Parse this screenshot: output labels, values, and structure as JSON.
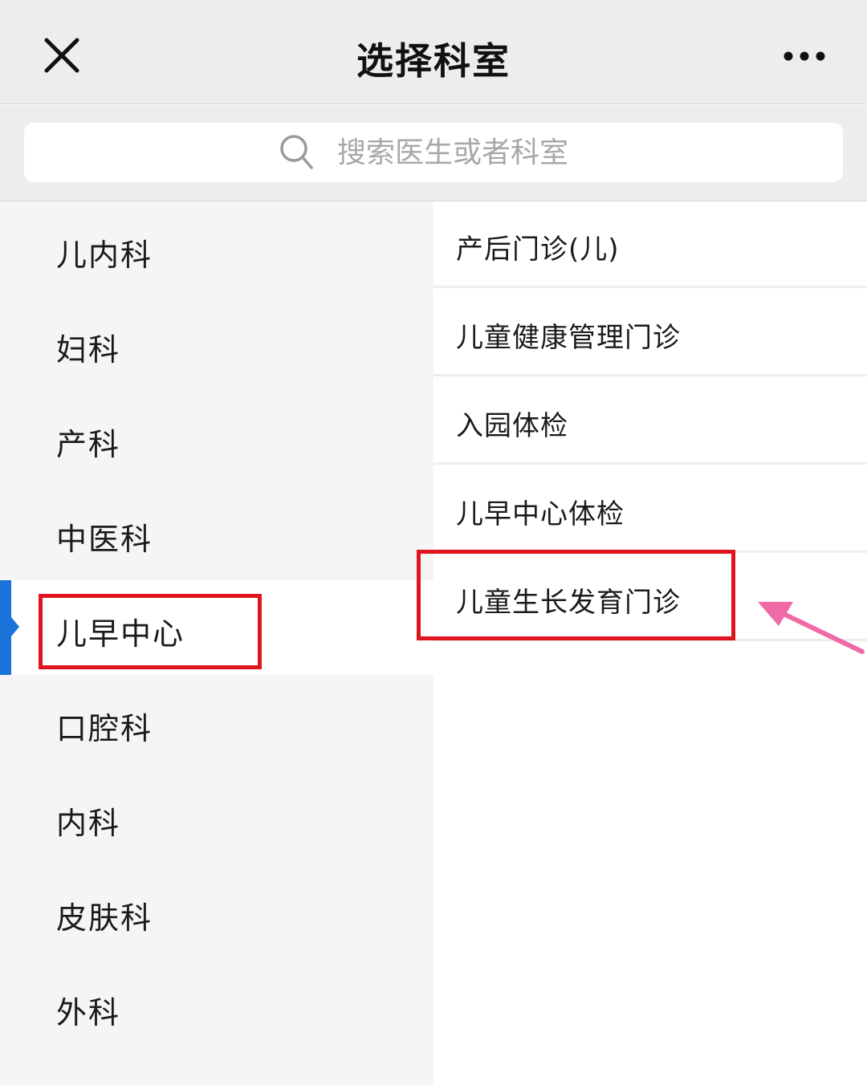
{
  "header": {
    "title": "选择科室"
  },
  "search": {
    "placeholder": "搜索医生或者科室"
  },
  "departments": [
    "儿内科",
    "妇科",
    "产科",
    "中医科",
    "儿早中心",
    "口腔科",
    "内科",
    "皮肤科",
    "外科"
  ],
  "selected_department": "儿早中心",
  "clinics": [
    "产后门诊(儿)",
    "儿童健康管理门诊",
    "入园体检",
    "儿早中心体检",
    "儿童生长发育门诊"
  ],
  "colors": {
    "accent": "#1a73d9",
    "highlight_box": "#e0141e",
    "arrow": "#f06aa5"
  }
}
